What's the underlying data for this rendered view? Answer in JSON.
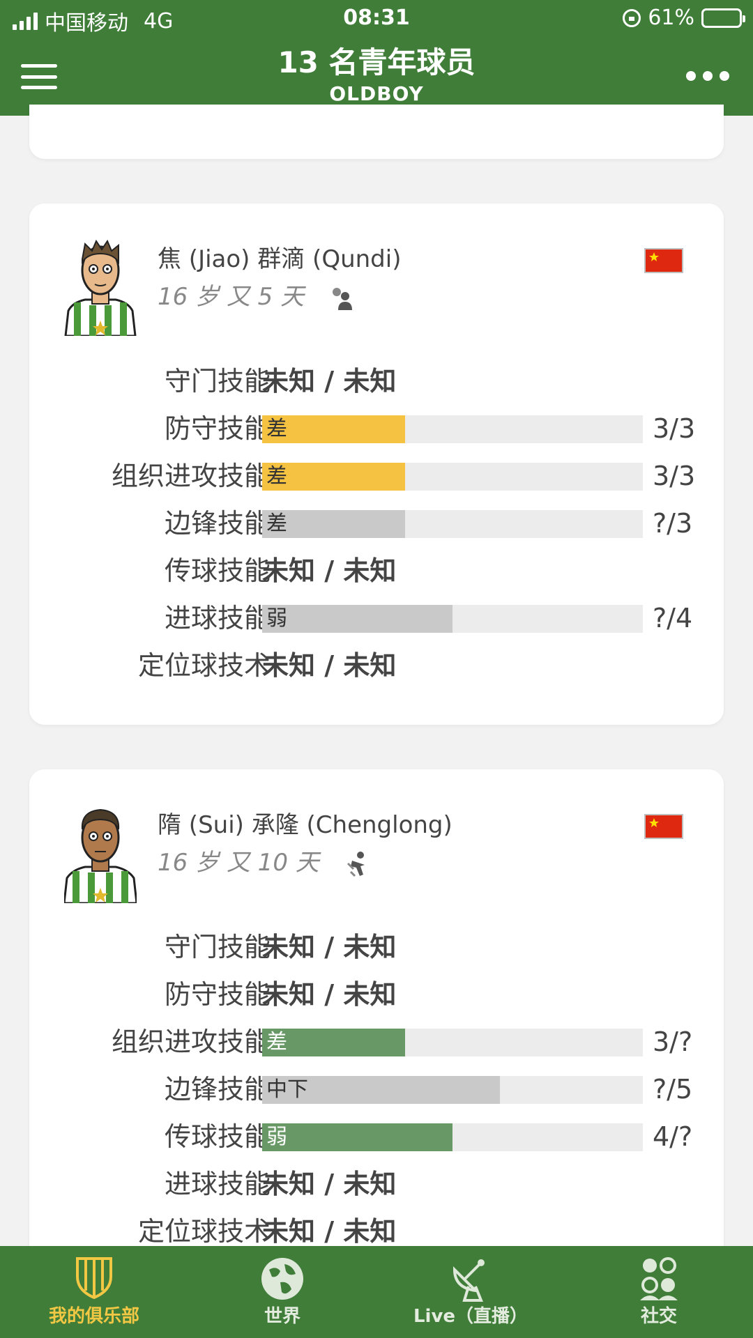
{
  "status_bar": {
    "carrier": "中国移动",
    "network": "4G",
    "time": "08:31",
    "battery": "61%"
  },
  "header": {
    "title": "13 名青年球员",
    "subtitle": "OLDBOY"
  },
  "colors": {
    "header_green": "#3f7d39",
    "bar_yellow": "#f5c242",
    "bar_gray": "#c9c9c9",
    "bar_green": "#689866",
    "track": "#ececec",
    "tab_active": "#f2c744"
  },
  "players": [
    {
      "name": "焦 (Jiao) 群滴 (Qundi)",
      "age": "16 岁 又 5 天",
      "status_icon": "scout-person-icon",
      "flag": "china-flag-icon",
      "skills": [
        {
          "label": "守门技能",
          "unknown": "未知 / 未知"
        },
        {
          "label": "防守技能",
          "bar_text": "差",
          "level": 0.375,
          "color": "yellow",
          "score": "3/3"
        },
        {
          "label": "组织进攻技能",
          "bar_text": "差",
          "level": 0.375,
          "color": "yellow",
          "score": "3/3"
        },
        {
          "label": "边锋技能",
          "bar_text": "差",
          "level": 0.375,
          "color": "gray",
          "score": "?/3"
        },
        {
          "label": "传球技能",
          "unknown": "未知 / 未知"
        },
        {
          "label": "进球技能",
          "bar_text": "弱",
          "level": 0.5,
          "color": "gray",
          "score": "?/4"
        },
        {
          "label": "定位球技术",
          "unknown": "未知 / 未知"
        }
      ]
    },
    {
      "name": "隋 (Sui) 承隆 (Chenglong)",
      "age": "16 岁 又 10 天",
      "status_icon": "training-icon",
      "flag": "china-flag-icon",
      "skills": [
        {
          "label": "守门技能",
          "unknown": "未知 / 未知"
        },
        {
          "label": "防守技能",
          "unknown": "未知 / 未知"
        },
        {
          "label": "组织进攻技能",
          "bar_text": "差",
          "level": 0.375,
          "color": "green",
          "score": "3/?"
        },
        {
          "label": "边锋技能",
          "bar_text": "中下",
          "level": 0.625,
          "color": "gray",
          "score": "?/5"
        },
        {
          "label": "传球技能",
          "bar_text": "弱",
          "level": 0.5,
          "color": "green",
          "score": "4/?"
        },
        {
          "label": "进球技能",
          "unknown": "未知 / 未知"
        },
        {
          "label": "定位球技术",
          "unknown": "未知 / 未知"
        }
      ]
    }
  ],
  "tabbar": [
    {
      "label": "我的俱乐部",
      "icon": "club-shield-icon",
      "active": true
    },
    {
      "label": "世界",
      "icon": "globe-icon",
      "active": false
    },
    {
      "label": "Live（直播）",
      "icon": "satellite-dish-icon",
      "active": false
    },
    {
      "label": "社交",
      "icon": "people-icon",
      "active": false
    }
  ]
}
